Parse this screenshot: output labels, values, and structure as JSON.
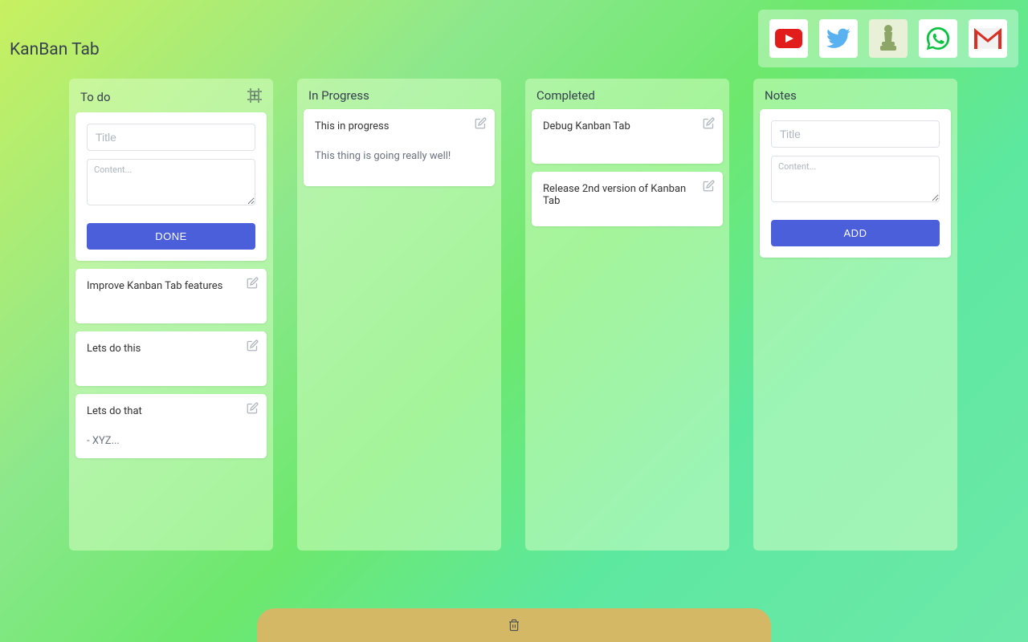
{
  "app_title": "KanBan Tab",
  "shortcuts": [
    {
      "name": "youtube"
    },
    {
      "name": "twitter"
    },
    {
      "name": "chess"
    },
    {
      "name": "whatsapp"
    },
    {
      "name": "gmail"
    }
  ],
  "columns": {
    "todo": {
      "title": "To do",
      "form": {
        "title_placeholder": "Title",
        "content_placeholder": "Content...",
        "button": "DONE"
      },
      "cards": [
        {
          "title": "Improve Kanban Tab features",
          "body": ""
        },
        {
          "title": "Lets do this",
          "body": ""
        },
        {
          "title": "Lets do that",
          "body": "- XYZ..."
        }
      ]
    },
    "in_progress": {
      "title": "In Progress",
      "cards": [
        {
          "title": "This in progress",
          "body": "This thing is going really well!"
        }
      ]
    },
    "completed": {
      "title": "Completed",
      "cards": [
        {
          "title": "Debug Kanban Tab",
          "body": ""
        },
        {
          "title": "Release 2nd version of Kanban Tab",
          "body": ""
        }
      ]
    },
    "notes": {
      "title": "Notes",
      "form": {
        "title_placeholder": "Title",
        "content_placeholder": "Content...",
        "button": "ADD"
      },
      "cards": []
    }
  }
}
